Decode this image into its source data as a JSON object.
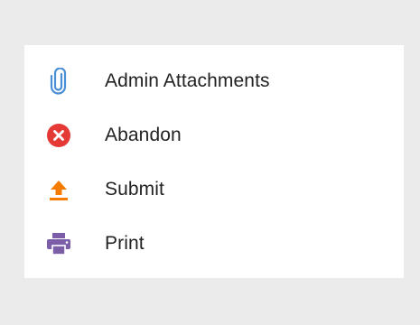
{
  "menu": {
    "items": [
      {
        "label": "Admin Attachments",
        "icon": "paperclip-icon",
        "color": "#4a8fd6"
      },
      {
        "label": "Abandon",
        "icon": "cancel-icon",
        "color": "#e53935"
      },
      {
        "label": "Submit",
        "icon": "upload-icon",
        "color": "#f57c00"
      },
      {
        "label": "Print",
        "icon": "printer-icon",
        "color": "#7b5ea7"
      }
    ]
  },
  "colors": {
    "background": "#ebebeb",
    "panel": "#ffffff",
    "text": "#222222"
  }
}
